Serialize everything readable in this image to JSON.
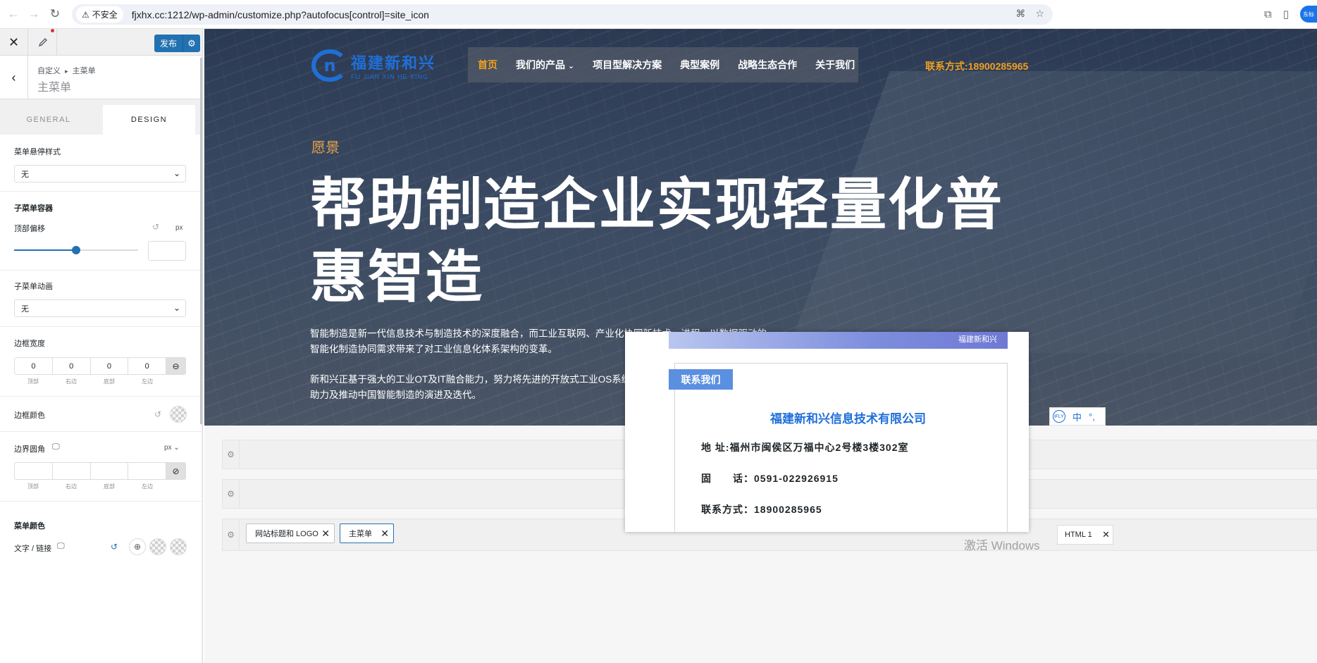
{
  "browser": {
    "insecure_label": "不安全",
    "url": "fjxhx.cc:1212/wp-admin/customize.php?autofocus[control]=site_icon",
    "profile_label": "东标"
  },
  "customizer": {
    "publish_label": "发布",
    "breadcrumb_root": "自定义",
    "breadcrumb_sep": "▸",
    "breadcrumb_current": "主菜单",
    "panel_title": "主菜单",
    "tabs": [
      "GENERAL",
      "DESIGN"
    ],
    "active_tab": "DESIGN",
    "hover_style_label": "菜单悬停样式",
    "hover_style_value": "无",
    "submenu_container_label": "子菜单容器",
    "top_offset_label": "顶部偏移",
    "top_offset_unit": "px",
    "top_offset_level": 0.5,
    "submenu_animation_label": "子菜单动画",
    "submenu_animation_value": "无",
    "border_width_label": "边框宽度",
    "border_width_values": [
      "0",
      "0",
      "0",
      "0"
    ],
    "side_labels": [
      "顶部",
      "右边",
      "底部",
      "左边"
    ],
    "border_color_label": "边框颜色",
    "border_radius_label": "边界圆角",
    "border_radius_unit": "px",
    "menu_color_label": "菜单颜色",
    "text_link_label": "文字 / 链接"
  },
  "site": {
    "logo_cn": "福建新和兴",
    "logo_en": "FU JIAN XIN HE XING",
    "nav": [
      "首页",
      "我们的产品",
      "项目型解决方案",
      "典型案例",
      "战略生态合作",
      "关于我们"
    ],
    "nav_active": "首页",
    "contact_top": "联系方式:18900285965",
    "vision": "愿景",
    "headline": "帮助制造企业实现轻量化普惠智造",
    "para1": "智能制造是新一代信息技术与制造技术的深度融合，而工业互联网、产业化协同新技术、进程，以数据驱动的智能化制造协同需求带来了对工业信息化体系架构的变革。",
    "para2": "新和兴正基于强大的工业OT及IT融合能力，努力将先进的开放式工业OS系统布局到每一个生产运营领域，全面助力及推动中国智能制造的演进及迭代。",
    "accent_color": "#f0a020",
    "brand_color": "#1f6fd8"
  },
  "builder": {
    "chips": [
      "网站标题和 LOGO",
      "主菜单"
    ],
    "html_chip": "HTML 1"
  },
  "card": {
    "banner_text": "福建新和兴",
    "tag": "联系我们",
    "company": "福建新和兴信息技术有限公司",
    "address": "地 址:福州市闽侯区万福中心2号楼3楼302室",
    "phone": "固　　话：0591-022926915",
    "contact": "联系方式：18900285965"
  },
  "ime": {
    "lang": "中"
  },
  "watermark": "激活 Windows"
}
